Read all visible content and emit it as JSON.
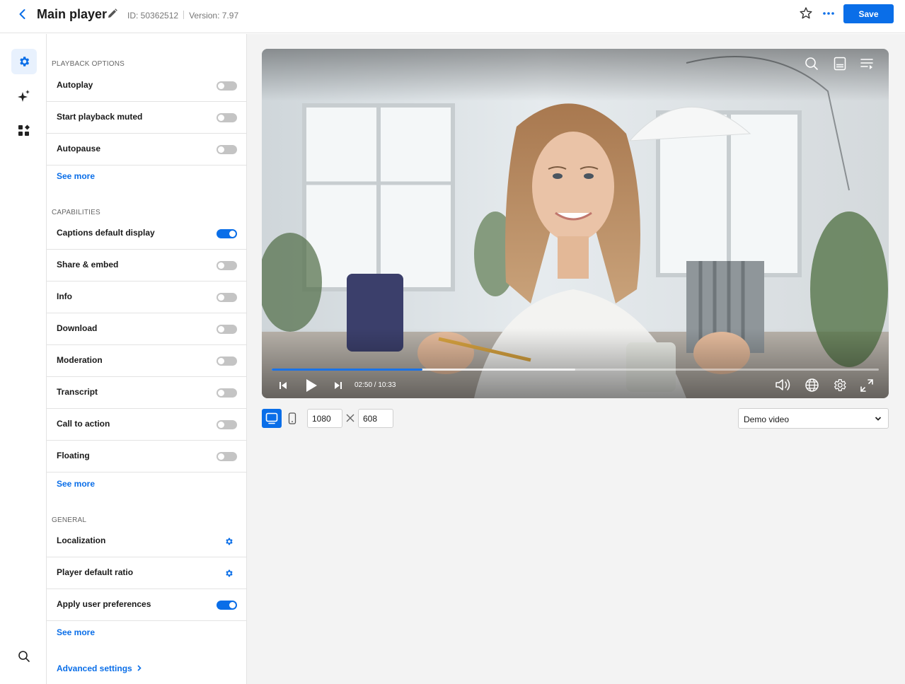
{
  "header": {
    "title": "Main player",
    "id_text": "ID: 50362512",
    "version_text": "Version: 7.97",
    "save_label": "Save"
  },
  "rail": {
    "items": [
      {
        "icon": "gear-icon",
        "active": true
      },
      {
        "icon": "sparkle-icon",
        "active": false
      },
      {
        "icon": "widgets-icon",
        "active": false
      }
    ],
    "bottom_icon": "search-icon"
  },
  "panel": {
    "playback": {
      "title": "PLAYBACK OPTIONS",
      "items": [
        {
          "label": "Autoplay",
          "on": false
        },
        {
          "label": "Start playback muted",
          "on": false
        },
        {
          "label": "Autopause",
          "on": false
        }
      ],
      "see_more": "See more"
    },
    "capabilities": {
      "title": "CAPABILITIES",
      "items": [
        {
          "label": "Captions default display",
          "on": true
        },
        {
          "label": "Share & embed",
          "on": false
        },
        {
          "label": "Info",
          "on": false
        },
        {
          "label": "Download",
          "on": false
        },
        {
          "label": "Moderation",
          "on": false
        },
        {
          "label": "Transcript",
          "on": false
        },
        {
          "label": "Call to action",
          "on": false
        },
        {
          "label": "Floating",
          "on": false
        }
      ],
      "see_more": "See more"
    },
    "general": {
      "title": "GENERAL",
      "items": [
        {
          "label": "Localization",
          "control": "gear"
        },
        {
          "label": "Player default ratio",
          "control": "gear"
        },
        {
          "label": "Apply user preferences",
          "control": "toggle",
          "on": true
        }
      ],
      "see_more": "See more"
    },
    "advanced_label": "Advanced settings"
  },
  "player": {
    "current_time": "02:50",
    "duration": "10:33",
    "time_text": "02:50 / 10:33",
    "progress": 0.248,
    "buffered": 0.5
  },
  "toolbar": {
    "width": "1080",
    "height": "608",
    "demo_select": "Demo video"
  },
  "colors": {
    "accent": "#0a6ee8",
    "toggle_off": "#c4c4c4"
  }
}
